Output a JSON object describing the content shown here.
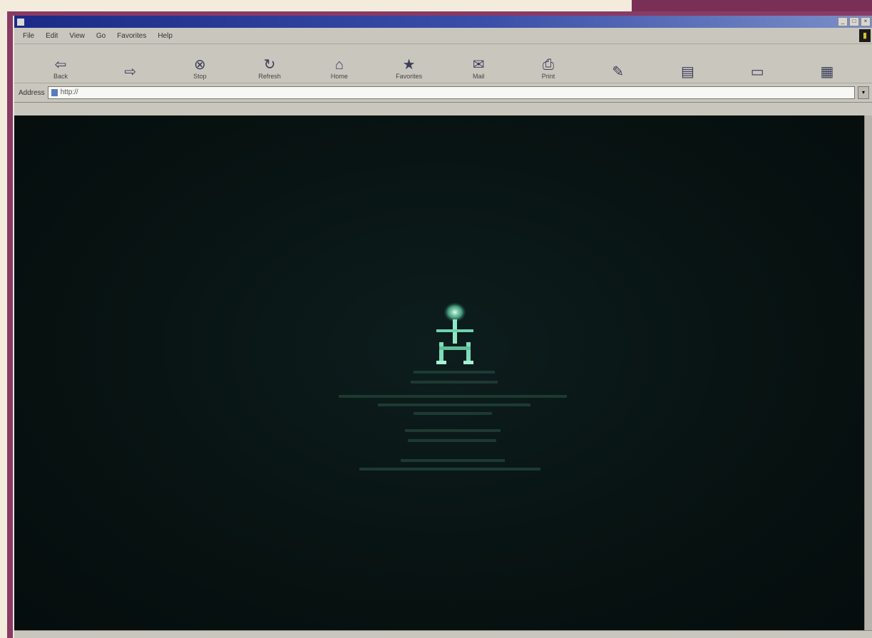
{
  "window": {
    "title": "",
    "controls": [
      "_",
      "□",
      "×"
    ]
  },
  "menu": [
    "File",
    "Edit",
    "View",
    "Go",
    "Favorites",
    "Help"
  ],
  "toolbar": [
    {
      "label": "Back",
      "icon": "back-arrow-icon"
    },
    {
      "label": "",
      "icon": "forward-arrow-icon"
    },
    {
      "label": "Stop",
      "icon": "stop-icon"
    },
    {
      "label": "Refresh",
      "icon": "refresh-icon"
    },
    {
      "label": "Home",
      "icon": "home-icon"
    },
    {
      "label": "Favorites",
      "icon": "favorites-icon"
    },
    {
      "label": "Mail",
      "icon": "mail-icon"
    },
    {
      "label": "Print",
      "icon": "print-icon"
    },
    {
      "label": "",
      "icon": "edit-icon"
    },
    {
      "label": "",
      "icon": "discuss-icon"
    },
    {
      "label": "",
      "icon": "messenger-icon"
    },
    {
      "label": "",
      "icon": "media-icon"
    }
  ],
  "address": {
    "label": "Address",
    "url": "http://"
  },
  "page": {
    "background": "#081413",
    "text_color": "#4a7f6c",
    "welcome_line1": "",
    "welcome_line2": ""
  }
}
